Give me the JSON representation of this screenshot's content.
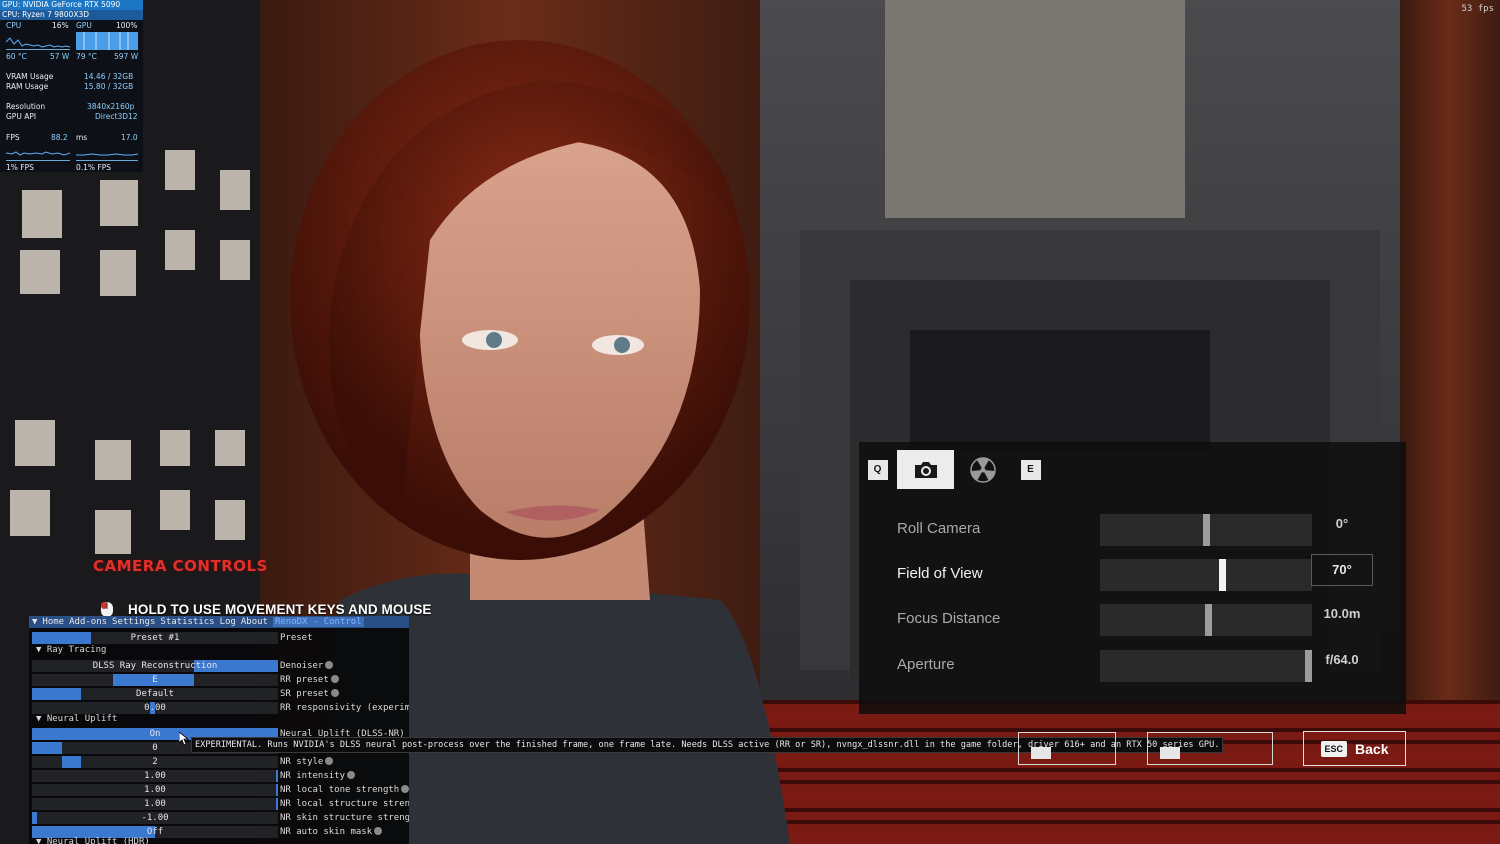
{
  "perf": {
    "gpu_name": "GPU: NVIDIA GeForce RTX 5090",
    "cpu_name": "CPU: Ryzen 7 9800X3D",
    "cpu_label": "CPU",
    "cpu_pct": "16%",
    "gpu_label": "GPU",
    "gpu_pct": "100%",
    "cpu_temp": "60 °C",
    "cpu_power": "57 W",
    "gpu_temp": "79 °C",
    "gpu_power": "597 W",
    "vram_label": "VRAM Usage",
    "vram_value": "14.46 / 32GB",
    "ram_label": "RAM Usage",
    "ram_value": "15.80 / 32GB",
    "res_label": "Resolution",
    "res_value": "3840x2160p",
    "api_label": "GPU API",
    "api_value": "Direct3D12",
    "fps_label": "FPS",
    "fps_value": "88.2",
    "ms_label": "ms",
    "ms_value": "17.0",
    "low1_label": "1% FPS",
    "low01_label": "0.1% FPS"
  },
  "fps_counter": "53 fps",
  "camera_controls": {
    "title": "CAMERA CONTROLS",
    "hold_hint": "HOLD TO USE MOVEMENT KEYS AND MOUSE"
  },
  "reshade": {
    "menu": [
      "Home",
      "Add-ons",
      "Settings",
      "Statistics",
      "Log",
      "About",
      "RenoDX - Control"
    ],
    "rows": [
      {
        "kind": "control",
        "value": "Preset #1",
        "fill": 0.24,
        "label": "Preset",
        "reset": false
      },
      {
        "kind": "section",
        "label": "▼ Ray Tracing"
      },
      {
        "kind": "control",
        "value": "DLSS Ray Reconstruction",
        "fill": 1.0,
        "fill_start": 0.66,
        "label": "Denoiser",
        "reset": true
      },
      {
        "kind": "control",
        "value": "E",
        "fill": 0.66,
        "fill_start": 0.33,
        "label": "RR preset",
        "reset": true
      },
      {
        "kind": "control",
        "value": "Default",
        "fill": 0.2,
        "label": "SR preset",
        "reset": true
      },
      {
        "kind": "control",
        "value": "0.00",
        "fill": 0.5,
        "fill_start": 0.48,
        "label": "RR responsivity (experim",
        "reset": false
      },
      {
        "kind": "section",
        "label": "▼ Neural Uplift"
      },
      {
        "kind": "control",
        "value": "On",
        "fill": 1.0,
        "label": "Neural Uplift (DLSS-NR)",
        "reset": false
      },
      {
        "kind": "control",
        "value": "0",
        "fill": 0.12,
        "label": "",
        "reset": false
      },
      {
        "kind": "control",
        "value": "2",
        "fill": 0.2,
        "fill_start": 0.12,
        "label": "NR style",
        "reset": true
      },
      {
        "kind": "control",
        "value": "1.00",
        "fill": 1.0,
        "fill_start": 0.99,
        "label": "NR intensity",
        "reset": true
      },
      {
        "kind": "control",
        "value": "1.00",
        "fill": 1.0,
        "fill_start": 0.99,
        "label": "NR local tone strength",
        "reset": true
      },
      {
        "kind": "control",
        "value": "1.00",
        "fill": 1.0,
        "fill_start": 0.99,
        "label": "NR local structure stren",
        "reset": false
      },
      {
        "kind": "control",
        "value": "-1.00",
        "fill": 0.02,
        "label": "NR skin structure streng",
        "reset": false
      },
      {
        "kind": "control",
        "value": "Off",
        "fill": 0.5,
        "label": "NR auto skin mask",
        "reset": true
      },
      {
        "kind": "section",
        "label": "▼ Neural Uplift (HDR)"
      }
    ]
  },
  "tooltip": "EXPERIMENTAL. Runs NVIDIA's DLSS neural post-process over the finished frame, one frame late. Needs DLSS active (RR or SR), nvngx_dlssnr.dll in the game folder, driver 616+ and an RTX 50 series GPU.",
  "photo_mode": {
    "tab_left_key": "Q",
    "tab_right_key": "E",
    "tabs": [
      "camera-icon",
      "radiation-icon"
    ],
    "rows": [
      {
        "name": "Roll Camera",
        "value": "0°",
        "level": 0.5,
        "selected": false
      },
      {
        "name": "Field of View",
        "value": "70°",
        "level": 0.58,
        "selected": true
      },
      {
        "name": "Focus Distance",
        "value": "10.0m",
        "level": 0.51,
        "selected": false
      },
      {
        "name": "Aperture",
        "value": "f/64.0",
        "level": 1.0,
        "selected": false
      }
    ],
    "back_key": "ESC",
    "back_label": "Back"
  },
  "colors": {
    "accent_blue": "#3b78cf",
    "menu_bar": "#2a4f86",
    "title_red": "#e0302a"
  }
}
